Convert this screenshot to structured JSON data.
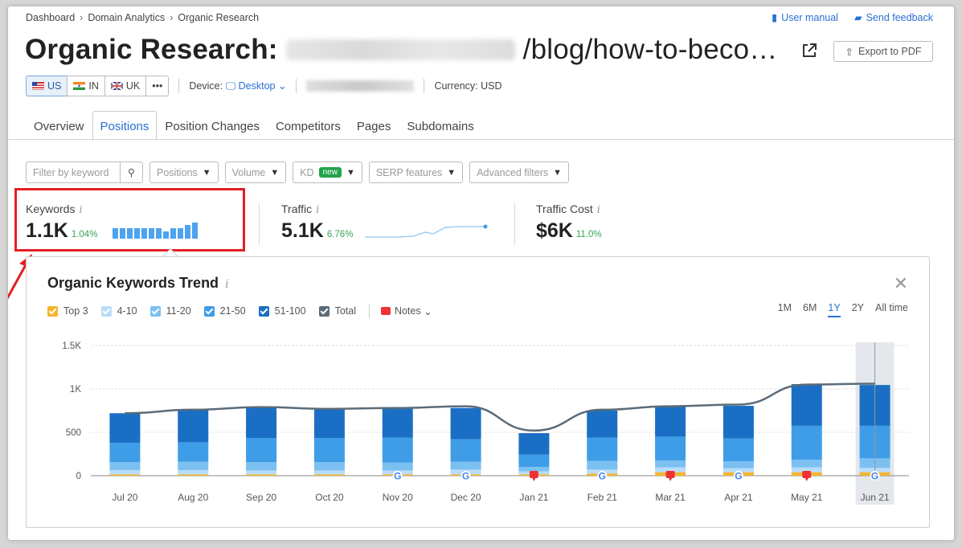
{
  "breadcrumb": [
    "Dashboard",
    "Domain Analytics",
    "Organic Research"
  ],
  "toplinks": {
    "manual": "User manual",
    "feedback": "Send feedback"
  },
  "header": {
    "title_prefix": "Organic Research:",
    "url_suffix": "/blog/how-to-beco…",
    "export_label": "Export to PDF"
  },
  "databases": [
    {
      "code": "US",
      "active": true
    },
    {
      "code": "IN",
      "active": false
    },
    {
      "code": "UK",
      "active": false
    },
    {
      "code": "•••",
      "active": false
    }
  ],
  "device": {
    "label": "Device:",
    "value": "Desktop"
  },
  "currency": "Currency: USD",
  "tabs": [
    "Overview",
    "Positions",
    "Position Changes",
    "Competitors",
    "Pages",
    "Subdomains"
  ],
  "active_tab": 1,
  "filters": {
    "keyword_placeholder": "Filter by keyword",
    "positions": "Positions",
    "volume": "Volume",
    "kd": "KD",
    "kd_badge": "new",
    "serp": "SERP features",
    "advanced": "Advanced filters"
  },
  "metrics": [
    {
      "label": "Keywords",
      "value": "1.1K",
      "change": "1.04%"
    },
    {
      "label": "Traffic",
      "value": "5.1K",
      "change": "6.76%"
    },
    {
      "label": "Traffic Cost",
      "value": "$6K",
      "change": "11.0%"
    }
  ],
  "trend": {
    "title": "Organic Keywords Trend",
    "legend": [
      {
        "label": "Top 3",
        "color": "#f5b431"
      },
      {
        "label": "4-10",
        "color": "#b9dcf8"
      },
      {
        "label": "11-20",
        "color": "#7cc0f2"
      },
      {
        "label": "21-50",
        "color": "#3f9de8"
      },
      {
        "label": "51-100",
        "color": "#1a6fc4"
      },
      {
        "label": "Total",
        "color": "#5b6b78"
      }
    ],
    "notes_label": "Notes",
    "ranges": [
      "1M",
      "6M",
      "1Y",
      "2Y",
      "All time"
    ],
    "active_range": "1Y"
  },
  "chart_data": {
    "type": "bar",
    "stacked": true,
    "categories": [
      "Jul 20",
      "Aug 20",
      "Sep 20",
      "Oct 20",
      "Nov 20",
      "Dec 20",
      "Jan 21",
      "Feb 21",
      "Mar 21",
      "Apr 21",
      "May 21",
      "Jun 21"
    ],
    "yticks": [
      "0",
      "500",
      "1K",
      "1.5K"
    ],
    "ylim": [
      0,
      1500
    ],
    "series": [
      {
        "name": "Top 3",
        "color": "#f5b431",
        "values": [
          15,
          15,
          15,
          15,
          15,
          15,
          15,
          25,
          40,
          40,
          40,
          40
        ]
      },
      {
        "name": "4-10",
        "color": "#b9dcf8",
        "values": [
          50,
          50,
          45,
          45,
          45,
          55,
          35,
          45,
          55,
          45,
          55,
          50
        ]
      },
      {
        "name": "11-20",
        "color": "#7cc0f2",
        "values": [
          90,
          95,
          95,
          95,
          90,
          90,
          50,
          100,
          80,
          80,
          90,
          110
        ]
      },
      {
        "name": "21-50",
        "color": "#3f9de8",
        "values": [
          225,
          225,
          280,
          280,
          290,
          260,
          145,
          270,
          275,
          265,
          390,
          375
        ]
      },
      {
        "name": "51-100",
        "color": "#1a6fc4",
        "values": [
          340,
          375,
          360,
          325,
          340,
          360,
          245,
          310,
          345,
          375,
          480,
          470
        ]
      }
    ],
    "total": [
      720,
      760,
      790,
      770,
      780,
      800,
      520,
      760,
      800,
      820,
      1050,
      1060
    ],
    "markers": {
      "Nov 20": "google",
      "Dec 20": "google",
      "Jan 21": "note",
      "Feb 21": "google",
      "Mar 21": "note",
      "Apr 21": "google",
      "May 21": "note",
      "Jun 21": "google"
    },
    "highlighted": "Jun 21"
  }
}
